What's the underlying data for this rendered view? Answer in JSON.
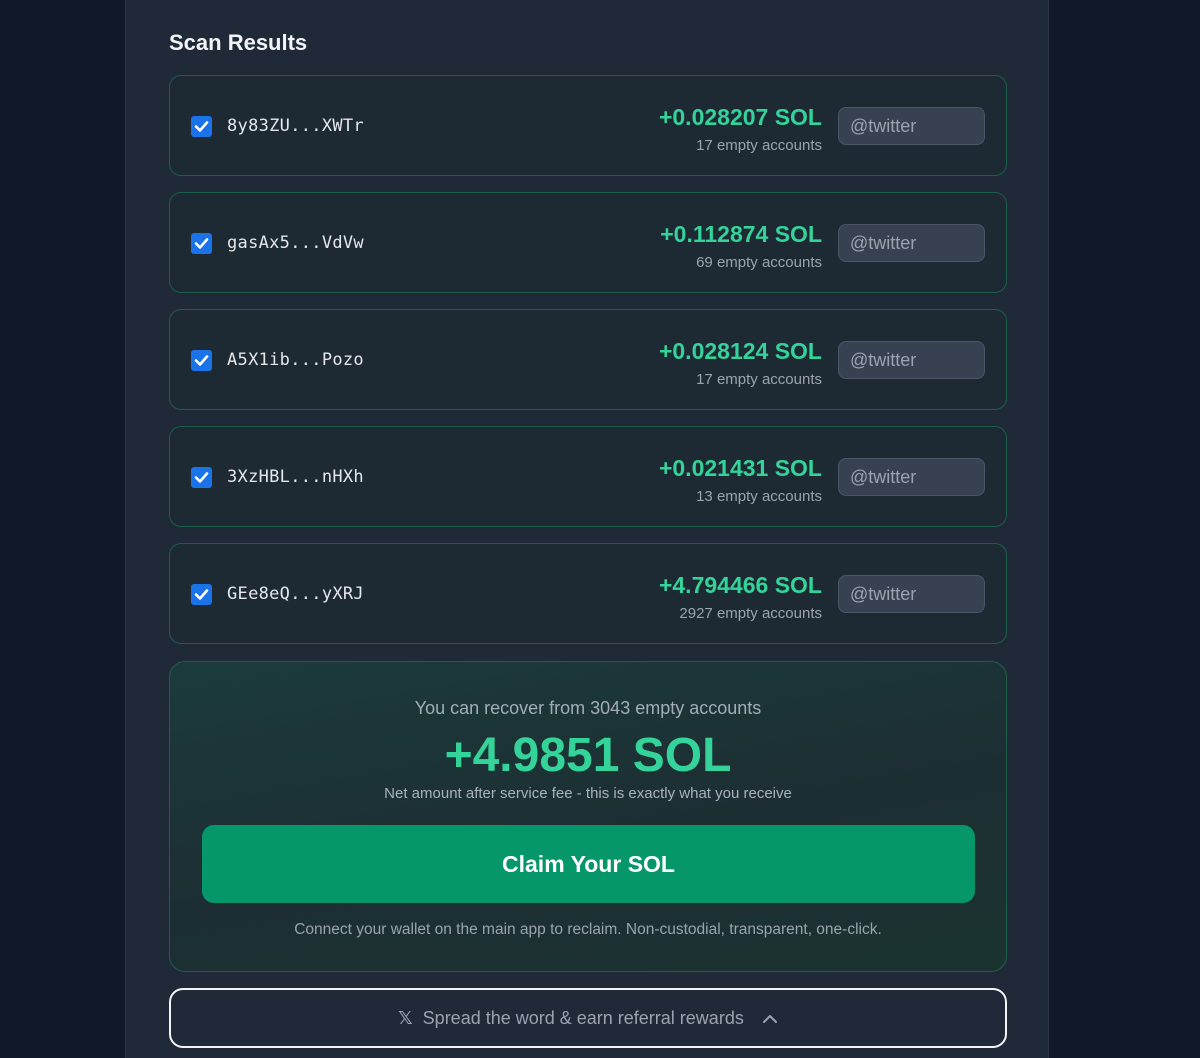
{
  "section_title": "Scan Results",
  "wallets": [
    {
      "address": "8y83ZU...XWTr",
      "amount": "+0.028207 SOL",
      "accounts": "17 empty accounts",
      "checked": true,
      "twitter_placeholder": "@twitter"
    },
    {
      "address": "gasAx5...VdVw",
      "amount": "+0.112874 SOL",
      "accounts": "69 empty accounts",
      "checked": true,
      "twitter_placeholder": "@twitter"
    },
    {
      "address": "A5X1ib...Pozo",
      "amount": "+0.028124 SOL",
      "accounts": "17 empty accounts",
      "checked": true,
      "twitter_placeholder": "@twitter"
    },
    {
      "address": "3XzHBL...nHXh",
      "amount": "+0.021431 SOL",
      "accounts": "13 empty accounts",
      "checked": true,
      "twitter_placeholder": "@twitter"
    },
    {
      "address": "GEe8eQ...yXRJ",
      "amount": "+4.794466 SOL",
      "accounts": "2927 empty accounts",
      "checked": true,
      "twitter_placeholder": "@twitter"
    }
  ],
  "summary": {
    "headline": "You can recover from 3043 empty accounts",
    "total": "+4.9851 SOL",
    "note": "Net amount after service fee - this is exactly what you receive",
    "claim_label": "Claim Your SOL",
    "footer": "Connect your wallet on the main app to reclaim. Non-custodial, transparent, one-click."
  },
  "referral": {
    "icon": "x-logo-icon",
    "label": "Spread the word & earn referral rewards",
    "chevron_icon": "chevron-up-icon"
  },
  "colors": {
    "accent_green": "#34d399",
    "button_green": "#059669",
    "checkbox_blue": "#1a73e8"
  }
}
